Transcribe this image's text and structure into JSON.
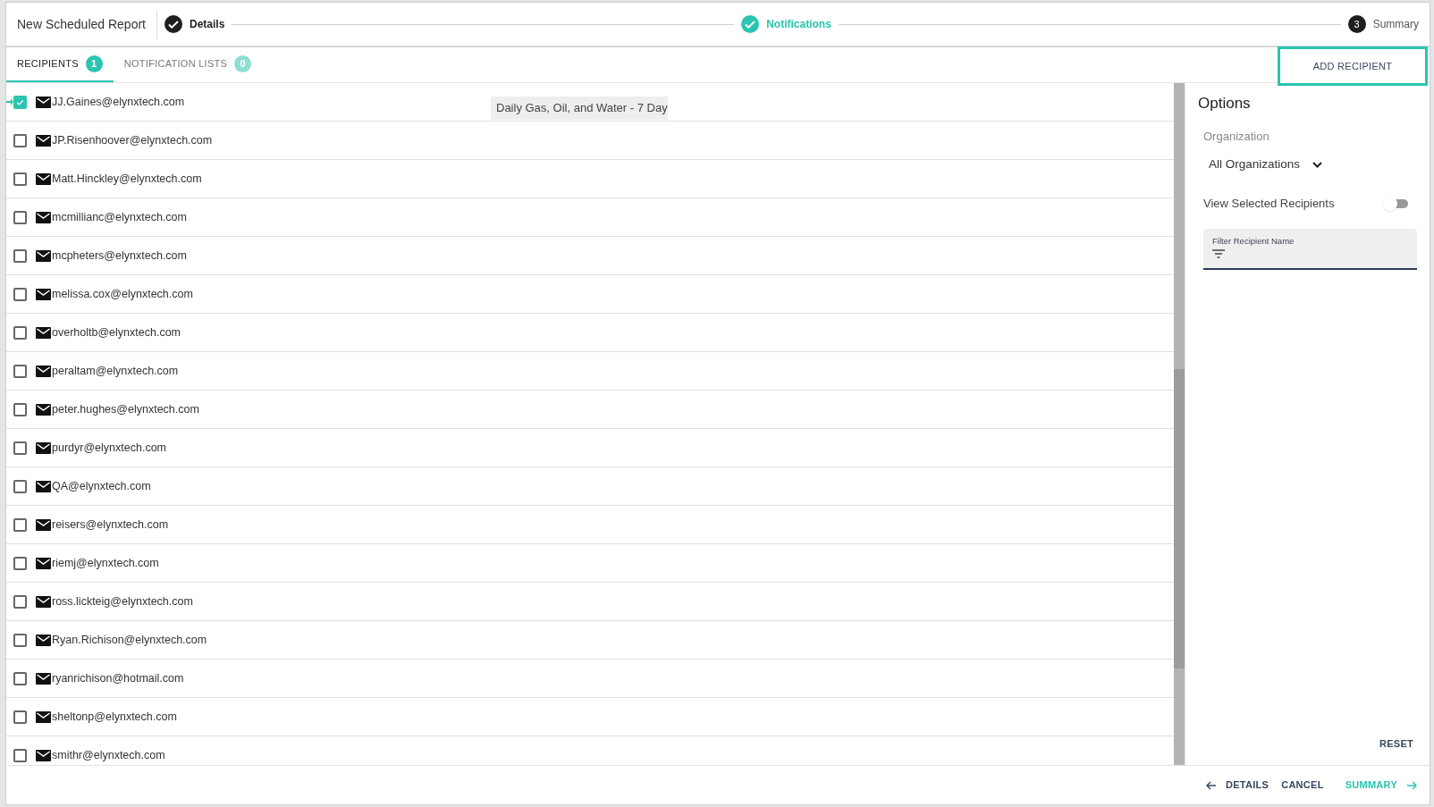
{
  "header": {
    "title": "New Scheduled Report"
  },
  "steps": [
    {
      "label": "Details",
      "done": true,
      "active": false
    },
    {
      "label": "Notifications",
      "done": true,
      "active": true
    },
    {
      "label": "Summary",
      "done": false,
      "active": false,
      "number": "3"
    }
  ],
  "tabs": [
    {
      "label": "RECIPIENTS",
      "count": "1",
      "selected": true
    },
    {
      "label": "NOTIFICATION LISTS",
      "count": "0",
      "selected": false
    }
  ],
  "add_button": "ADD RECIPIENT",
  "tooltip": "Daily Gas, Oil, and Water - 7 Day",
  "recipients": [
    {
      "email": "JJ.Gaines@elynxtech.com",
      "checked": true
    },
    {
      "email": "JP.Risenhoover@elynxtech.com",
      "checked": false
    },
    {
      "email": "Matt.Hinckley@elynxtech.com",
      "checked": false
    },
    {
      "email": "mcmillianc@elynxtech.com",
      "checked": false
    },
    {
      "email": "mcpheters@elynxtech.com",
      "checked": false
    },
    {
      "email": "melissa.cox@elynxtech.com",
      "checked": false
    },
    {
      "email": "overholtb@elynxtech.com",
      "checked": false
    },
    {
      "email": "peraltam@elynxtech.com",
      "checked": false
    },
    {
      "email": "peter.hughes@elynxtech.com",
      "checked": false
    },
    {
      "email": "purdyr@elynxtech.com",
      "checked": false
    },
    {
      "email": "QA@elynxtech.com",
      "checked": false
    },
    {
      "email": "reisers@elynxtech.com",
      "checked": false
    },
    {
      "email": "riemj@elynxtech.com",
      "checked": false
    },
    {
      "email": "ross.lickteig@elynxtech.com",
      "checked": false
    },
    {
      "email": "Ryan.Richison@elynxtech.com",
      "checked": false
    },
    {
      "email": "ryanrichison@hotmail.com",
      "checked": false
    },
    {
      "email": "sheltonp@elynxtech.com",
      "checked": false
    },
    {
      "email": "smithr@elynxtech.com",
      "checked": false
    }
  ],
  "options": {
    "title": "Options",
    "organization_label": "Organization",
    "organization_value": "All Organizations",
    "view_selected_label": "View Selected Recipients",
    "view_selected_on": false,
    "filter_label": "Filter Recipient Name",
    "reset": "RESET"
  },
  "footer": {
    "back": "DETAILS",
    "cancel": "CANCEL",
    "next": "SUMMARY"
  }
}
